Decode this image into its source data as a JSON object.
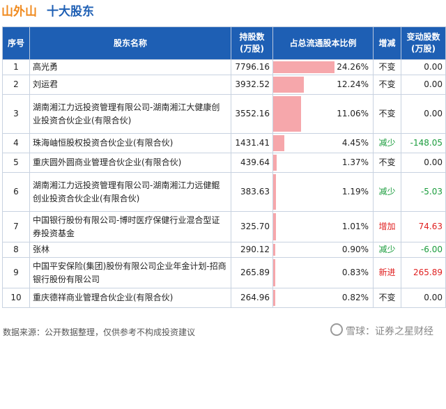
{
  "header": {
    "company": "山外山",
    "title": "十大股东"
  },
  "table": {
    "columns": [
      "序号",
      "股东名称",
      "持股数\n(万股)",
      "占总流通股本比例",
      "增减",
      "变动股数\n(万股)"
    ],
    "rows": [
      {
        "idx": "1",
        "name": "高光勇",
        "shares": "7796.16",
        "ratio": "24.26%",
        "ratio_value": 24.26,
        "change": "不变",
        "change_type": "same",
        "delta": "0.00"
      },
      {
        "idx": "2",
        "name": "刘运君",
        "shares": "3932.52",
        "ratio": "12.24%",
        "ratio_value": 12.24,
        "change": "不变",
        "change_type": "same",
        "delta": "0.00"
      },
      {
        "idx": "3",
        "name": "湖南湘江力远投资管理有限公司-湖南湘江大健康创业投资合伙企业(有限合伙)",
        "shares": "3552.16",
        "ratio": "11.06%",
        "ratio_value": 11.06,
        "change": "不变",
        "change_type": "same",
        "delta": "0.00"
      },
      {
        "idx": "4",
        "name": "珠海岫恒股权投资合伙企业(有限合伙)",
        "shares": "1431.41",
        "ratio": "4.45%",
        "ratio_value": 4.45,
        "change": "减少",
        "change_type": "down",
        "delta": "-148.05"
      },
      {
        "idx": "5",
        "name": "重庆圆外圆商业管理合伙企业(有限合伙)",
        "shares": "439.64",
        "ratio": "1.37%",
        "ratio_value": 1.37,
        "change": "不变",
        "change_type": "same",
        "delta": "0.00"
      },
      {
        "idx": "6",
        "name": "湖南湘江力远投资管理有限公司-湖南湘江力远健鲲创业投资合伙企业(有限合伙)",
        "shares": "383.63",
        "ratio": "1.19%",
        "ratio_value": 1.19,
        "change": "减少",
        "change_type": "down",
        "delta": "-5.03"
      },
      {
        "idx": "7",
        "name": "中国银行股份有限公司-博时医疗保健行业混合型证券投资基金",
        "shares": "325.70",
        "ratio": "1.01%",
        "ratio_value": 1.01,
        "change": "增加",
        "change_type": "up",
        "delta": "74.63"
      },
      {
        "idx": "8",
        "name": "张林",
        "shares": "290.12",
        "ratio": "0.90%",
        "ratio_value": 0.9,
        "change": "减少",
        "change_type": "down",
        "delta": "-6.00"
      },
      {
        "idx": "9",
        "name": "中国平安保险(集团)股份有限公司企业年金计划-招商银行股份有限公司",
        "shares": "265.89",
        "ratio": "0.83%",
        "ratio_value": 0.83,
        "change": "新进",
        "change_type": "up",
        "delta": "265.89"
      },
      {
        "idx": "10",
        "name": "重庆德祥商业管理合伙企业(有限合伙)",
        "shares": "264.96",
        "ratio": "0.82%",
        "ratio_value": 0.82,
        "change": "不变",
        "change_type": "same",
        "delta": "0.00"
      }
    ]
  },
  "footer": {
    "source": "数据来源：公开数据整理，仅供参考不构成投资建议"
  },
  "brand": {
    "text": "雪球：证券之星财经"
  },
  "colors": {
    "header_bg": "#1e5fb4",
    "bar": "#f6a7ab",
    "up": "#e02020",
    "down": "#1a9c3c",
    "company": "#f08a1e"
  }
}
